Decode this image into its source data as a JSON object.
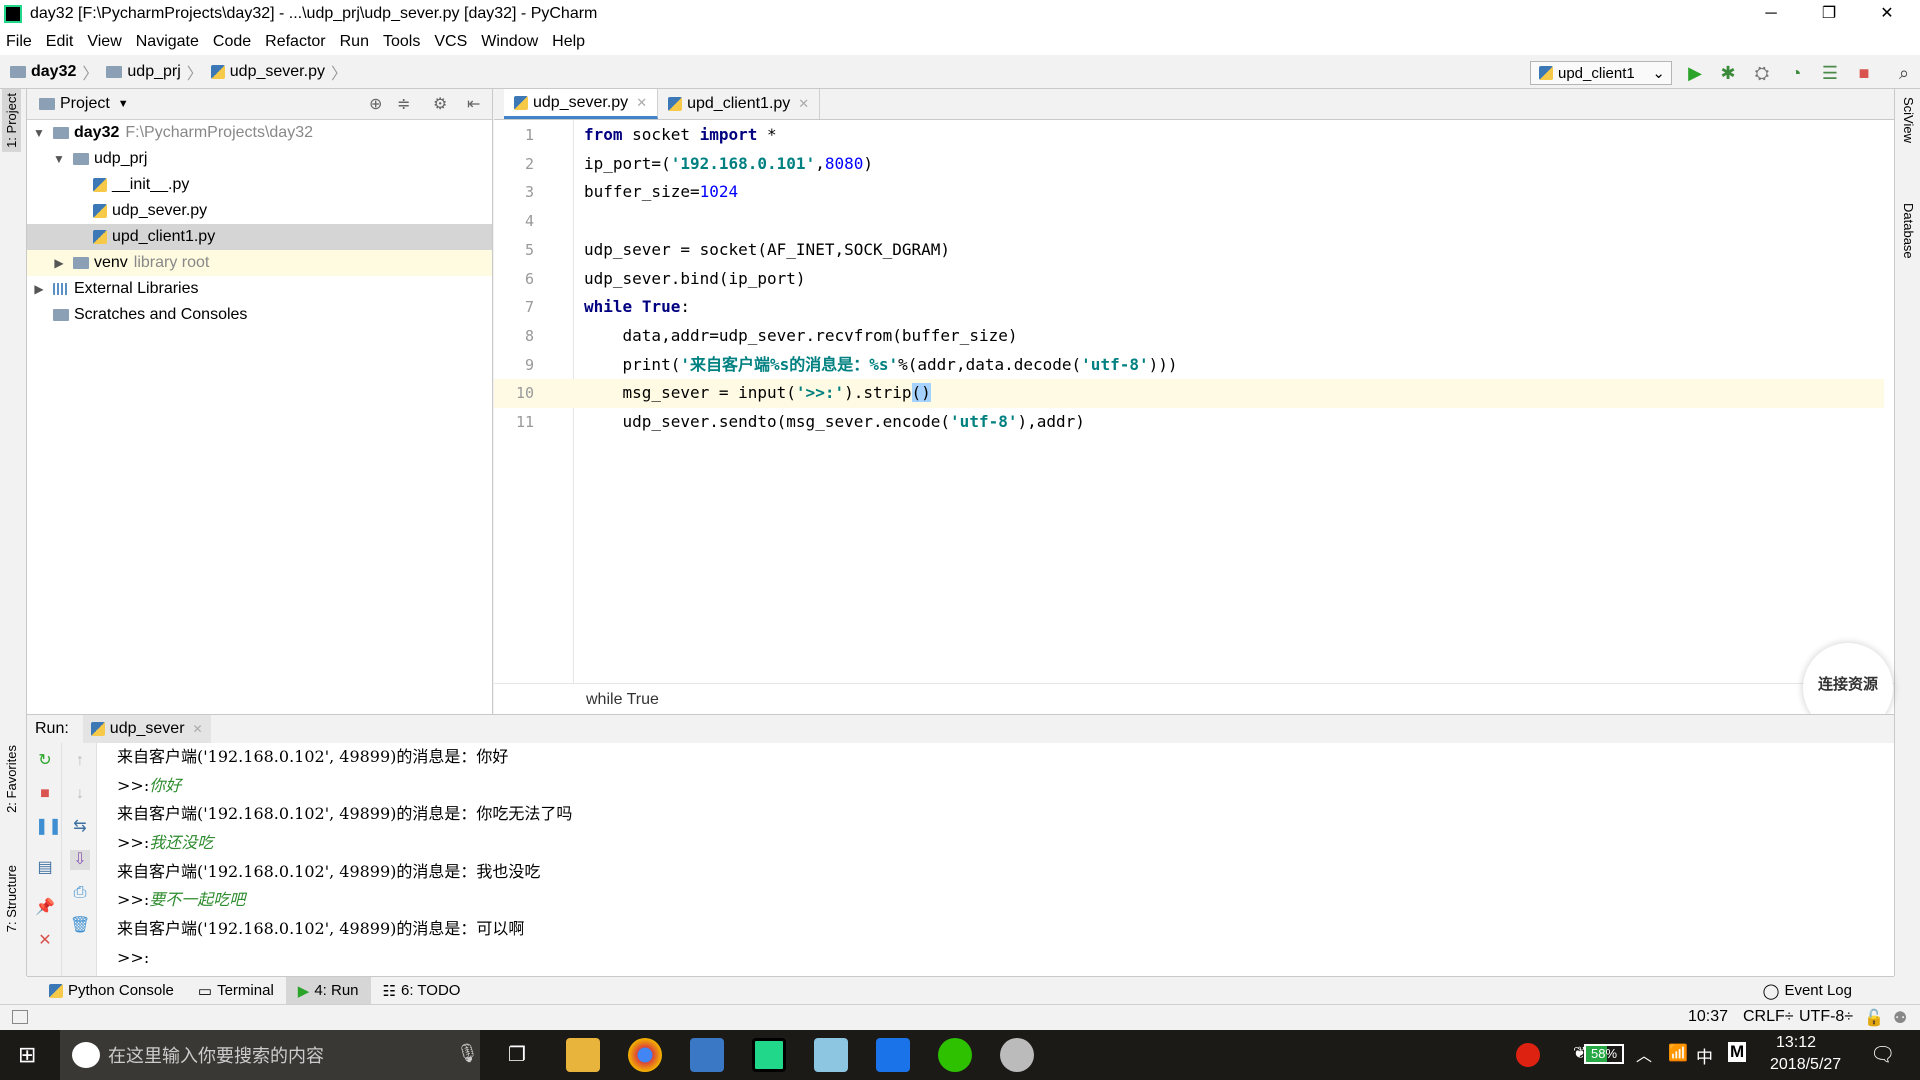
{
  "window": {
    "title": "day32 [F:\\PycharmProjects\\day32] - ...\\udp_prj\\udp_sever.py [day32] - PyCharm",
    "minimize": "─",
    "restore": "❐",
    "close": "✕"
  },
  "menu": [
    "File",
    "Edit",
    "View",
    "Navigate",
    "Code",
    "Refactor",
    "Run",
    "Tools",
    "VCS",
    "Window",
    "Help"
  ],
  "nav": {
    "crumbs": [
      "day32",
      "udp_prj",
      "udp_sever.py"
    ],
    "run_config": "upd_client1"
  },
  "project": {
    "header": "Project",
    "tree": [
      {
        "label": "day32",
        "hint": "F:\\PycharmProjects\\day32",
        "depth": 0,
        "arrow": "▼",
        "icon": "folder",
        "bold": true
      },
      {
        "label": "udp_prj",
        "depth": 1,
        "arrow": "▼",
        "icon": "folder"
      },
      {
        "label": "__init__.py",
        "depth": 2,
        "icon": "py"
      },
      {
        "label": "udp_sever.py",
        "depth": 2,
        "icon": "py"
      },
      {
        "label": "upd_client1.py",
        "depth": 2,
        "icon": "py",
        "selected": true
      },
      {
        "label": "venv",
        "hint": "library root",
        "depth": 1,
        "arrow": "▶",
        "icon": "folder",
        "highlight": true
      },
      {
        "label": "External Libraries",
        "depth": 0,
        "arrow": "▶",
        "icon": "lib"
      },
      {
        "label": "Scratches and Consoles",
        "depth": 0,
        "icon": "scratch"
      }
    ]
  },
  "editor": {
    "tabs": [
      {
        "label": "udp_sever.py",
        "active": true
      },
      {
        "label": "upd_client1.py"
      }
    ],
    "current_line": 10,
    "lines": [
      [
        [
          "kw",
          "from"
        ],
        [
          "plain",
          " socket "
        ],
        [
          "kw",
          "import"
        ],
        [
          "plain",
          " *"
        ]
      ],
      [
        [
          "plain",
          "ip_port=("
        ],
        [
          "str",
          "'192.168.0.101'"
        ],
        [
          "plain",
          ","
        ],
        [
          "num",
          "8080"
        ],
        [
          "plain",
          ")"
        ]
      ],
      [
        [
          "plain",
          "buffer_size="
        ],
        [
          "num",
          "1024"
        ]
      ],
      [],
      [
        [
          "plain",
          "udp_sever = socket(AF_INET,SOCK_DGRAM)"
        ]
      ],
      [
        [
          "plain",
          "udp_sever.bind(ip_port)"
        ]
      ],
      [
        [
          "kw",
          "while"
        ],
        [
          "plain",
          " "
        ],
        [
          "kw",
          "True"
        ],
        [
          "plain",
          ":"
        ]
      ],
      [
        [
          "plain",
          "    data,addr=udp_sever.recvfrom(buffer_size)"
        ]
      ],
      [
        [
          "plain",
          "    print("
        ],
        [
          "str",
          "'来自客户端%s的消息是：%s'"
        ],
        [
          "plain",
          "%(addr,data.decode("
        ],
        [
          "str",
          "'utf-8'"
        ],
        [
          "plain",
          ")))"
        ]
      ],
      [
        [
          "plain",
          "    msg_sever = input("
        ],
        [
          "str",
          "'>>:'"
        ],
        [
          "plain",
          ").strip"
        ],
        [
          "sel",
          "()"
        ]
      ],
      [
        [
          "plain",
          "    udp_sever.sendto(msg_sever.encode("
        ],
        [
          "str",
          "'utf-8'"
        ],
        [
          "plain",
          "),addr)"
        ]
      ]
    ],
    "breadcrumb": "while True"
  },
  "badge": "连接资源",
  "run": {
    "label": "Run:",
    "tab": "udp_sever",
    "output": [
      {
        "text": "来自客户端('192.168.0.102', 49899)的消息是：你好"
      },
      {
        "prompt": ">>:",
        "input": "你好"
      },
      {
        "text": "来自客户端('192.168.0.102', 49899)的消息是：你吃无法了吗"
      },
      {
        "prompt": ">>:",
        "input": "我还没吃"
      },
      {
        "text": "来自客户端('192.168.0.102', 49899)的消息是：我也没吃"
      },
      {
        "prompt": ">>:",
        "input": "要不一起吃吧"
      },
      {
        "text": "来自客户端('192.168.0.102', 49899)的消息是：可以啊"
      },
      {
        "prompt": ">>:",
        "input": ""
      }
    ]
  },
  "side_tabs": {
    "project": "1: Project",
    "favorites": "2: Favorites",
    "structure": "7: Structure",
    "sciview": "SciView",
    "database": "Database"
  },
  "tool_tabs": [
    "Python Console",
    "Terminal",
    "4: Run",
    "6: TODO"
  ],
  "event_log": "Event Log",
  "status": {
    "position": "10:37",
    "line_sep": "CRLF÷",
    "encoding": "UTF-8÷"
  },
  "taskbar": {
    "search_placeholder": "在这里输入你要搜索的内容",
    "battery": "58%",
    "ime": "中",
    "ime2": "M",
    "time": "13:12",
    "date": "2018/5/27"
  }
}
